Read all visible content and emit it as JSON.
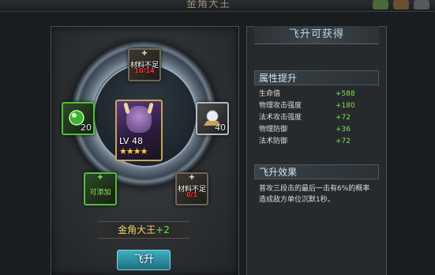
{
  "top": {
    "title": "金角大王"
  },
  "slots": {
    "top": {
      "plus": "+",
      "label": "材料不足",
      "count": "10/14"
    },
    "left": {
      "count": "20"
    },
    "right": {
      "count": "40"
    },
    "bottom_left": {
      "plus": "+",
      "label": "可添加"
    },
    "bottom_right": {
      "plus": "+",
      "label": "材料不足",
      "count": "0/1"
    }
  },
  "hero": {
    "level": "LV 48",
    "stars": "★★★★"
  },
  "name_bar": {
    "name": "金角大王",
    "bonus": "+2"
  },
  "ascend_button": "飞升",
  "right_panel": {
    "title": "飞升可获得",
    "attr_header": "属性提升",
    "stats": [
      {
        "name": "生命值",
        "value": "+588"
      },
      {
        "name": "物理攻击强度",
        "value": "+180"
      },
      {
        "name": "法术攻击强度",
        "value": "+72"
      },
      {
        "name": "物理防御",
        "value": "+36"
      },
      {
        "name": "法术防御",
        "value": "+72"
      }
    ],
    "effect_header": "飞升效果",
    "effect_text": "普攻三段击的最后一击有6%的概率造成敌方单位沉默1秒。"
  },
  "colors": {
    "gold": "#f0d070",
    "green_value": "#7ee04e",
    "red_count": "#ff3030",
    "button": "#2a93a4"
  }
}
